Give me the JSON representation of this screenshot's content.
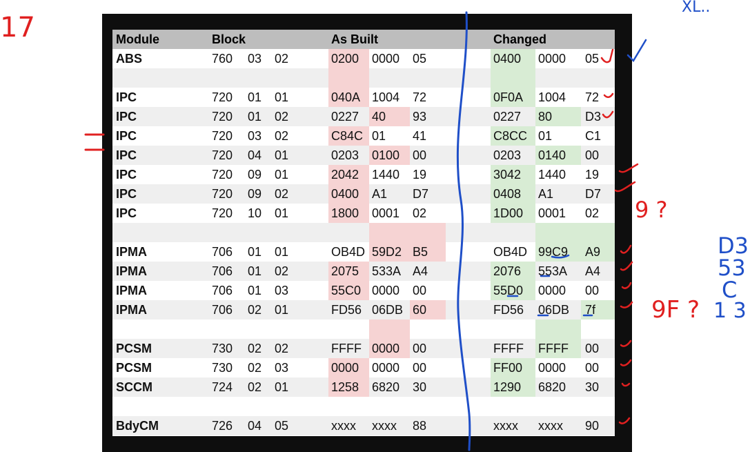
{
  "table": {
    "headers": {
      "module": "Module",
      "block": "Block",
      "as_built": "As Built",
      "changed": "Changed"
    },
    "rows": [
      {
        "cells": [
          "ABS",
          "760",
          "03",
          "02",
          "0200",
          "0000",
          "05",
          "0400",
          "0000",
          "05"
        ]
      },
      {
        "cells": []
      },
      {
        "cells": [
          "IPC",
          "720",
          "01",
          "01",
          "040A",
          "1004",
          "72",
          "0F0A",
          "1004",
          "72"
        ]
      },
      {
        "cells": [
          "IPC",
          "720",
          "01",
          "02",
          "0227",
          "40",
          "93",
          "0227",
          "80",
          "D3"
        ]
      },
      {
        "cells": [
          "IPC",
          "720",
          "03",
          "02",
          "C84C",
          "01",
          "41",
          "C8CC",
          "01",
          "C1"
        ]
      },
      {
        "cells": [
          "IPC",
          "720",
          "04",
          "01",
          "0203",
          "0100",
          "00",
          "0203",
          "0140",
          "00"
        ]
      },
      {
        "cells": [
          "IPC",
          "720",
          "09",
          "01",
          "2042",
          "1440",
          "19",
          "3042",
          "1440",
          "19"
        ]
      },
      {
        "cells": [
          "IPC",
          "720",
          "09",
          "02",
          "0400",
          "A1",
          "D7",
          "0408",
          "A1",
          "D7"
        ]
      },
      {
        "cells": [
          "IPC",
          "720",
          "10",
          "01",
          "1800",
          "0001",
          "02",
          "1D00",
          "0001",
          "02"
        ]
      },
      {
        "cells": []
      },
      {
        "cells": [
          "IPMA",
          "706",
          "01",
          "01",
          "OB4D",
          "59D2",
          "B5",
          "OB4D",
          "99C9",
          "A9"
        ]
      },
      {
        "cells": [
          "IPMA",
          "706",
          "01",
          "02",
          "2075",
          "533A",
          "A4",
          "2076",
          "553A",
          "A4"
        ]
      },
      {
        "cells": [
          "IPMA",
          "706",
          "01",
          "03",
          "55C0",
          "0000",
          "00",
          "55D0",
          "0000",
          "00"
        ]
      },
      {
        "cells": [
          "IPMA",
          "706",
          "02",
          "01",
          "FD56",
          "06DB",
          "60",
          "FD56",
          "06DB",
          "7f"
        ]
      },
      {
        "cells": []
      },
      {
        "cells": [
          "PCSM",
          "730",
          "02",
          "02",
          "FFFF",
          "0000",
          "00",
          "FFFF",
          "FFFF",
          "00"
        ]
      },
      {
        "cells": [
          "PCSM",
          "730",
          "02",
          "03",
          "0000",
          "0000",
          "00",
          "FF00",
          "0000",
          "00"
        ]
      },
      {
        "cells": [
          "SCCM",
          "724",
          "02",
          "01",
          "1258",
          "6820",
          "30",
          "1290",
          "6820",
          "30"
        ]
      },
      {
        "cells": []
      },
      {
        "cells": [
          "BdyCM",
          "726",
          "04",
          "05",
          "xxxx",
          "xxxx",
          "88",
          "xxxx",
          "xxxx",
          "90"
        ]
      }
    ]
  },
  "annotations": {
    "top_left": "17",
    "top_right": "XL..",
    "question_9": "9 ?",
    "right_d3": "D3",
    "right_53": "53",
    "right_c": "C",
    "right_13": "1  3",
    "question_9f": "9F ?",
    "ink_red": "#e02020",
    "ink_blue": "#1f4fc8"
  },
  "colors": {
    "as_built_highlight": "#f6d3d3",
    "changed_highlight": "#d8ecd4",
    "header_bg": "#bdbdbd",
    "frame": "#0e0e0e"
  }
}
